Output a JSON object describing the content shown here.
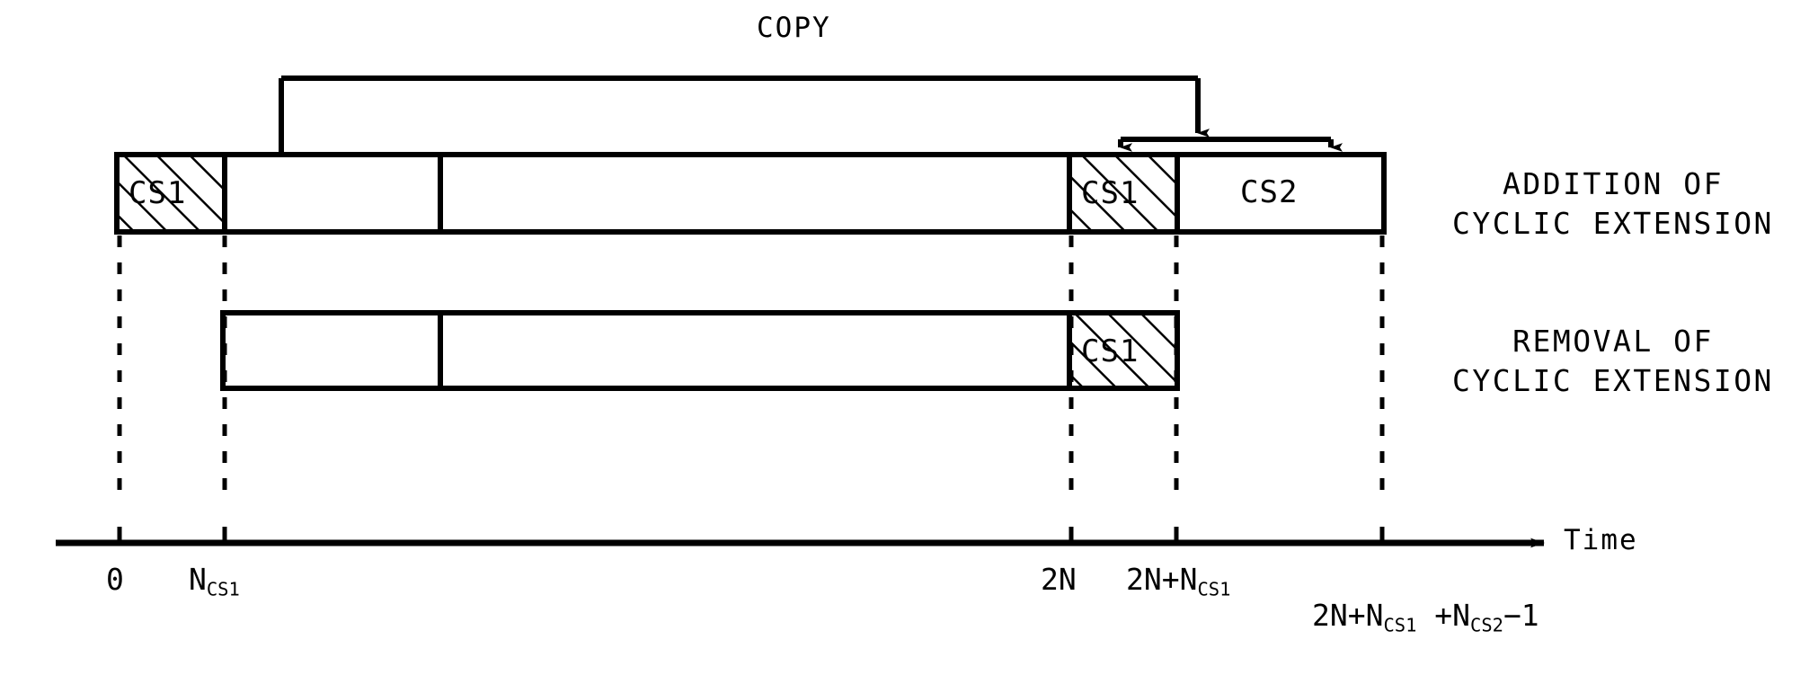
{
  "figure": {
    "title_label": "COPY",
    "axis_label": "Time"
  },
  "top_row": {
    "caption_line1": "ADDITION OF",
    "caption_line2": "CYCLIC EXTENSION",
    "segments": [
      {
        "name": "cs1-prefix",
        "label": "CS1",
        "hatched": true
      },
      {
        "name": "data-part-a",
        "label": "",
        "hatched": false
      },
      {
        "name": "data-part-b",
        "label": "",
        "hatched": false
      },
      {
        "name": "cs1-source",
        "label": "CS1",
        "hatched": true
      },
      {
        "name": "cs2-suffix",
        "label": "CS2",
        "hatched": false
      }
    ]
  },
  "bottom_row": {
    "caption_line1": "REMOVAL OF",
    "caption_line2": "CYCLIC EXTENSION",
    "segments": [
      {
        "name": "data-part-a",
        "label": "",
        "hatched": false
      },
      {
        "name": "data-part-b",
        "label": "",
        "hatched": false
      },
      {
        "name": "cs1-tail",
        "label": "CS1",
        "hatched": true
      }
    ]
  },
  "axis": {
    "ticks": [
      {
        "name": "tick-0",
        "main": "0",
        "sub": "",
        "tail": ""
      },
      {
        "name": "tick-ncs1",
        "main": "N",
        "sub": "CS1",
        "tail": ""
      },
      {
        "name": "tick-2n",
        "main": "2N",
        "sub": "",
        "tail": ""
      },
      {
        "name": "tick-2n-ncs1",
        "main": "2N+N",
        "sub": "CS1",
        "tail": ""
      }
    ],
    "last_tick": {
      "name": "tick-2n-ncs1-ncs2-m1",
      "p1": "2N+N",
      "s1": "CS1",
      "p2": " +N",
      "s2": "CS2",
      "p3": "−1"
    }
  },
  "colors": {
    "ink": "#000000",
    "paper": "#ffffff"
  }
}
